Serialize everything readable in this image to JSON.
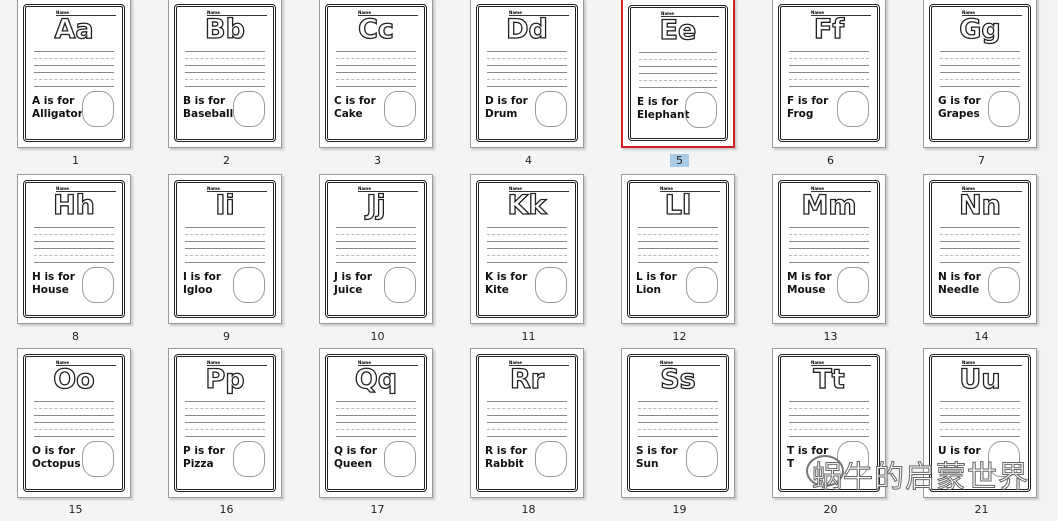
{
  "selected_page": 5,
  "accent_selected": "#d02020",
  "name_label": "Name",
  "is_for": "is for",
  "pages": [
    {
      "num": "1",
      "letters": "Aa",
      "caption": "A is for",
      "word": "Alligator"
    },
    {
      "num": "2",
      "letters": "Bb",
      "caption": "B is for",
      "word": "Baseball"
    },
    {
      "num": "3",
      "letters": "Cc",
      "caption": "C is for",
      "word": "Cake"
    },
    {
      "num": "4",
      "letters": "Dd",
      "caption": "D is for",
      "word": "Drum"
    },
    {
      "num": "5",
      "letters": "Ee",
      "caption": "E is for",
      "word": "Elephant"
    },
    {
      "num": "6",
      "letters": "Ff",
      "caption": "F is for",
      "word": "Frog"
    },
    {
      "num": "7",
      "letters": "Gg",
      "caption": "G is for",
      "word": "Grapes"
    },
    {
      "num": "8",
      "letters": "Hh",
      "caption": "H is for",
      "word": "House"
    },
    {
      "num": "9",
      "letters": "Ii",
      "caption": "I is for",
      "word": "Igloo"
    },
    {
      "num": "10",
      "letters": "Jj",
      "caption": "J is for",
      "word": "Juice"
    },
    {
      "num": "11",
      "letters": "Kk",
      "caption": "K is for",
      "word": "Kite"
    },
    {
      "num": "12",
      "letters": "Ll",
      "caption": "L is for",
      "word": "Lion"
    },
    {
      "num": "13",
      "letters": "Mm",
      "caption": "M is for",
      "word": "Mouse"
    },
    {
      "num": "14",
      "letters": "Nn",
      "caption": "N is for",
      "word": "Needle"
    },
    {
      "num": "15",
      "letters": "Oo",
      "caption": "O is for",
      "word": "Octopus"
    },
    {
      "num": "16",
      "letters": "Pp",
      "caption": "P is for",
      "word": "Pizza"
    },
    {
      "num": "17",
      "letters": "Qq",
      "caption": "Q is for",
      "word": "Queen"
    },
    {
      "num": "18",
      "letters": "Rr",
      "caption": "R is for",
      "word": "Rabbit"
    },
    {
      "num": "19",
      "letters": "Ss",
      "caption": "S is for",
      "word": "Sun"
    },
    {
      "num": "20",
      "letters": "Tt",
      "caption": "T is for",
      "word": "T"
    },
    {
      "num": "21",
      "letters": "Uu",
      "caption": "U is for",
      "word": ""
    }
  ],
  "watermark": "蜗牛的启蒙世界"
}
